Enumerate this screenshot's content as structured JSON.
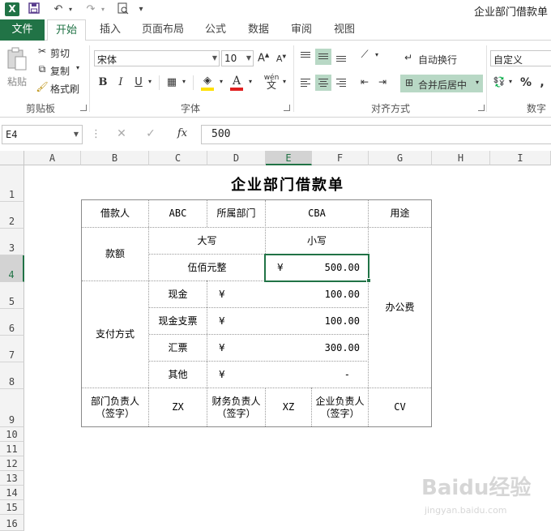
{
  "window": {
    "title": "企业部门借款单"
  },
  "tabs": [
    "文件",
    "开始",
    "插入",
    "页面布局",
    "公式",
    "数据",
    "审阅",
    "视图"
  ],
  "ribbon": {
    "clipboard": {
      "paste": "粘贴",
      "cut": "剪切",
      "copy": "复制",
      "format_painter": "格式刷",
      "label": "剪贴板"
    },
    "font": {
      "name": "宋体",
      "size": "10",
      "bold": "B",
      "italic": "I",
      "underline": "U",
      "label": "字体"
    },
    "alignment": {
      "wrap": "自动换行",
      "merge": "合并后居中",
      "label": "对齐方式"
    },
    "number": {
      "format": "自定义",
      "label": "数字",
      "percent": "%"
    }
  },
  "formula_bar": {
    "name_box": "E4",
    "formula": "500"
  },
  "sheet": {
    "columns": [
      "A",
      "B",
      "C",
      "D",
      "E",
      "F",
      "G",
      "H",
      "I"
    ],
    "selected_column": "E",
    "rows": [
      "1",
      "2",
      "3",
      "4",
      "5",
      "6",
      "7",
      "8",
      "9",
      "10",
      "11",
      "12",
      "13",
      "14",
      "15",
      "16"
    ],
    "selected_row": "4",
    "title": "企业部门借款单"
  },
  "form": {
    "borrower_label": "借款人",
    "borrower": "ABC",
    "dept_label": "所属部门",
    "dept": "CBA",
    "purpose_label": "用途",
    "amount_label": "款额",
    "upper_label": "大写",
    "lower_label": "小写",
    "amount_upper": "伍佰元整",
    "amount_currency": "¥",
    "amount_value": "500.00",
    "payment_label": "支付方式",
    "payments": [
      {
        "method": "现金",
        "currency": "¥",
        "value": "100.00"
      },
      {
        "method": "现金支票",
        "currency": "¥",
        "value": "100.00"
      },
      {
        "method": "汇票",
        "currency": "¥",
        "value": "300.00"
      },
      {
        "method": "其他",
        "currency": "¥",
        "value": "-"
      }
    ],
    "purpose": "办公费",
    "dept_head_label_1": "部门负责人",
    "dept_head_label_2": "（签字）",
    "dept_head": "ZX",
    "finance_head_label_1": "财务负责人",
    "finance_head_label_2": "（签字）",
    "finance_head": "XZ",
    "company_head_label_1": "企业负责人",
    "company_head_label_2": "（签字）",
    "company_head": "CV"
  },
  "watermark": {
    "text": "Baidu经验",
    "url": "jingyan.baidu.com"
  },
  "colors": {
    "excel_green": "#217346",
    "selected_toggle": "#b8d8c5",
    "font_color": "#e02020",
    "fill_color": "#ffe000"
  }
}
